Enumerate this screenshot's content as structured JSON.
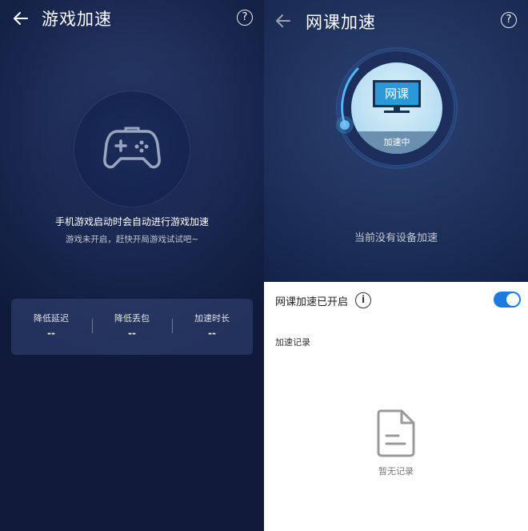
{
  "left_panel": {
    "title": "游戏加速",
    "help": "?",
    "message": "手机游戏启动时会自动进行游戏加速",
    "sub_message": "游戏未开启，赶快开局游戏试试吧~",
    "stats": [
      {
        "label": "降低延迟",
        "value": "--"
      },
      {
        "label": "降低丢包",
        "value": "--"
      },
      {
        "label": "加速时长",
        "value": "--"
      }
    ]
  },
  "right_panel": {
    "title": "网课加速",
    "help": "?",
    "monitor_text": "网课",
    "status_band": "加速中",
    "no_device": "当前没有设备加速",
    "toggle_label": "网课加速已开启",
    "info": "i",
    "toggle_on": true,
    "record_heading": "加速记录",
    "empty_text": "暂无记录"
  },
  "icons": {
    "back": "back-arrow-icon",
    "help": "help-icon",
    "gamepad": "gamepad-icon",
    "monitor": "monitor-icon",
    "info": "info-icon",
    "empty": "document-icon"
  },
  "colors": {
    "accent": "#1f7ae0",
    "dark_bg": "#142146",
    "monitor_screen": "#2b98d8"
  }
}
